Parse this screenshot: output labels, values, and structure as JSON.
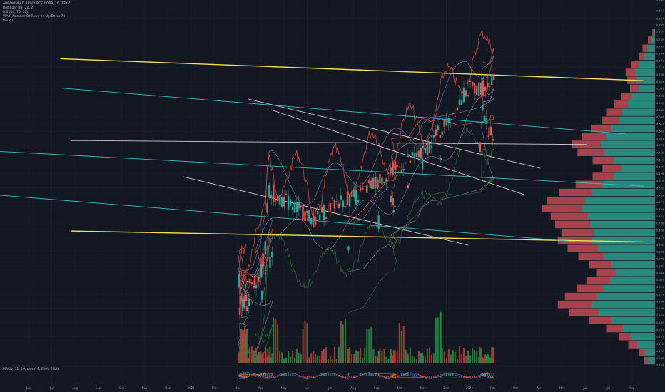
{
  "header": {
    "title": "ARROWHEAD RESOURCE CORP, 1D, TSXV",
    "indicators": [
      "Bollinger BB (20, 2)",
      "RSI (14, 70, 30)",
      "VPVR Number Of Rows 24 Up/Down 70",
      "Vol 20"
    ]
  },
  "macd_label": "MACD (12, 26, close, 9, EMA, EMA)",
  "colors": {
    "background": "#131722",
    "up": "#26a69a",
    "down": "#ef5350",
    "trend_yellow": "#f5e14a",
    "trend_cyan": "#2ec4c4",
    "trend_white": "#d7c7cc",
    "rsi": "#c4463f",
    "bb": "#8f95a8",
    "volume_up": "#1f8f3a",
    "volume_down": "#b83a3a",
    "profile_up": "#2e9c8c",
    "profile_down": "#c24a55"
  },
  "chart_data": {
    "type": "candlestick",
    "timeframe": "1D",
    "x_labels": [
      "Jun",
      "Jul",
      "Aug",
      "Sep",
      "Oct",
      "Nov",
      "Dec",
      "2021",
      "Feb",
      "Mar",
      "Apr",
      "May",
      "Jun",
      "Jul",
      "Aug",
      "Sep",
      "Oct",
      "Nov",
      "Dec",
      "2022",
      "Feb",
      "Mar",
      "Apr",
      "May",
      "Jun",
      "Jul",
      "Aug"
    ],
    "y_labels": [
      "0.840",
      "0.821",
      "0.807",
      "0.795",
      "0.782",
      "0.769",
      "0.757",
      "0.744",
      "0.731",
      "0.719",
      "0.706",
      "0.693",
      "0.681",
      "0.668",
      "0.655",
      "0.642",
      "0.630",
      "0.617",
      "0.604",
      "0.591",
      "0.579",
      "0.566",
      "0.553",
      "0.540",
      "0.528",
      "0.515",
      "0.502",
      "0.489",
      "0.477",
      "0.464",
      "0.451",
      "0.439",
      "0.426",
      "0.413",
      "0.400",
      "0.388",
      "0.375",
      "0.362",
      "0.349",
      "0.337",
      "0.324",
      "0.311",
      "0.298",
      "0.286",
      "0.273",
      "0.260",
      "0.247",
      "0.235",
      "0.222",
      "0.209",
      "0.196",
      "0.184"
    ],
    "ylim": [
      0.184,
      0.84
    ],
    "price_path": [
      [
        0.389,
        0.342
      ],
      [
        0.409,
        0.368
      ],
      [
        0.417,
        0.375
      ],
      [
        0.4,
        0.31
      ],
      [
        0.389,
        0.275
      ],
      [
        0.366,
        0.279
      ],
      [
        0.364,
        0.291
      ],
      [
        0.376,
        0.301
      ],
      [
        0.365,
        0.301
      ],
      [
        0.372,
        0.289
      ],
      [
        0.38,
        0.291
      ],
      [
        0.369,
        0.286
      ],
      [
        0.365,
        0.337
      ],
      [
        0.378,
        0.334
      ],
      [
        0.386,
        0.327
      ],
      [
        0.398,
        0.349
      ],
      [
        0.405,
        0.395
      ],
      [
        0.408,
        0.462
      ],
      [
        0.411,
        0.497
      ],
      [
        0.445,
        0.472
      ],
      [
        0.48,
        0.444
      ],
      [
        0.514,
        0.477
      ],
      [
        0.547,
        0.488
      ],
      [
        0.58,
        0.517
      ],
      [
        0.613,
        0.543
      ],
      [
        0.646,
        0.565
      ],
      [
        0.68,
        0.617
      ],
      [
        0.713,
        0.679
      ],
      [
        0.746,
        0.685
      ],
      [
        0.754,
        0.711
      ],
      [
        0.748,
        0.692
      ],
      [
        0.736,
        0.693
      ],
      [
        0.735,
        0.649
      ],
      [
        0.738,
        0.64
      ],
      [
        0.744,
        0.613
      ],
      [
        0.751,
        0.595
      ],
      [
        0.754,
        0.59
      ],
      [
        0.733,
        0.573
      ],
      [
        0.7,
        0.563
      ],
      [
        0.673,
        0.556
      ],
      [
        0.658,
        0.554
      ],
      [
        0.645,
        0.543
      ],
      [
        0.636,
        0.519
      ],
      [
        0.623,
        0.51
      ],
      [
        0.601,
        0.493
      ],
      [
        0.597,
        0.488
      ],
      [
        0.603,
        0.472
      ],
      [
        0.605,
        0.466
      ],
      [
        0.601,
        0.448
      ],
      [
        0.593,
        0.452
      ],
      [
        0.578,
        0.438
      ],
      [
        0.555,
        0.402
      ],
      [
        0.532,
        0.394
      ],
      [
        0.519,
        0.402
      ]
    ],
    "volume_ylim": [
      0,
      1
    ],
    "volume_spikes": [
      [
        0.085,
        0.35
      ],
      [
        0.132,
        0.42
      ],
      [
        0.176,
        0.38
      ],
      [
        0.229,
        0.47
      ],
      [
        0.283,
        0.33
      ],
      [
        0.372,
        0.36
      ],
      [
        0.422,
        0.51
      ],
      [
        0.465,
        0.4
      ],
      [
        0.523,
        0.44
      ],
      [
        0.563,
        0.37
      ],
      [
        0.614,
        0.41
      ],
      [
        0.669,
        0.58
      ]
    ],
    "trendlines": [
      {
        "color": "trend_yellow",
        "from": [
          0.092,
          0.839
        ],
        "to": [
          0.983,
          0.779
        ]
      },
      {
        "color": "trend_yellow",
        "from": [
          0.108,
          0.367
        ],
        "to": [
          0.983,
          0.337
        ]
      },
      {
        "color": "trend_cyan",
        "from": [
          0.092,
          0.759
        ],
        "to": [
          0.955,
          0.633
        ]
      },
      {
        "color": "trend_cyan",
        "from": [
          0.0,
          0.585
        ],
        "to": [
          0.983,
          0.49
        ]
      },
      {
        "color": "trend_cyan",
        "from": [
          0.0,
          0.465
        ],
        "to": [
          0.877,
          0.338
        ]
      },
      {
        "color": "trend_white",
        "from": [
          0.378,
          0.729
        ],
        "to": [
          0.825,
          0.539
        ]
      },
      {
        "color": "trend_white",
        "from": [
          0.414,
          0.699
        ],
        "to": [
          0.8,
          0.467
        ]
      },
      {
        "color": "trend_white",
        "from": [
          0.279,
          0.516
        ],
        "to": [
          0.715,
          0.328
        ]
      },
      {
        "color": "trend_white",
        "from": [
          0.108,
          0.615
        ],
        "to": [
          0.896,
          0.604
        ]
      }
    ],
    "volume_profile": {
      "rows": 42,
      "up": [
        0.02,
        0.05,
        0.09,
        0.12,
        0.18,
        0.22,
        0.21,
        0.19,
        0.26,
        0.31,
        0.37,
        0.4,
        0.49,
        0.55,
        0.61,
        0.57,
        0.46,
        0.39,
        0.47,
        0.59,
        0.71,
        0.79,
        0.82,
        0.76,
        0.73,
        0.69,
        0.71,
        0.64,
        0.57,
        0.49,
        0.44,
        0.51,
        0.58,
        0.66,
        0.71,
        0.63,
        0.49,
        0.36,
        0.27,
        0.2,
        0.12,
        0.08
      ],
      "down": [
        0.01,
        0.03,
        0.05,
        0.06,
        0.09,
        0.11,
        0.1,
        0.09,
        0.12,
        0.15,
        0.17,
        0.19,
        0.23,
        0.27,
        0.32,
        0.3,
        0.24,
        0.2,
        0.23,
        0.3,
        0.37,
        0.42,
        0.45,
        0.41,
        0.39,
        0.36,
        0.38,
        0.34,
        0.29,
        0.25,
        0.22,
        0.26,
        0.3,
        0.35,
        0.38,
        0.33,
        0.25,
        0.18,
        0.13,
        0.1,
        0.06,
        0.04
      ]
    }
  }
}
